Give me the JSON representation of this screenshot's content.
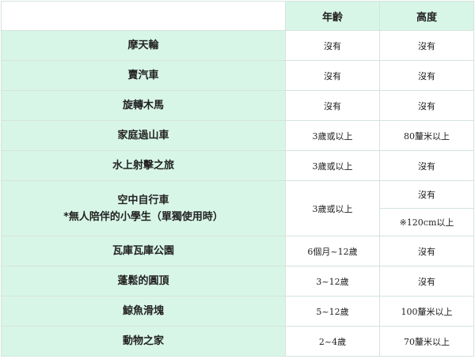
{
  "headers": {
    "age": "年齡",
    "height": "高度"
  },
  "rows": [
    {
      "name": "摩天輪",
      "age": "沒有",
      "height": "沒有"
    },
    {
      "name": "賣汽車",
      "age": "沒有",
      "height": "沒有"
    },
    {
      "name": "旋轉木馬",
      "age": "沒有",
      "height": "沒有"
    },
    {
      "name": "家庭過山車",
      "age": "3歲或以上",
      "height": "80釐米以上"
    },
    {
      "name": "水上射擊之旅",
      "age": "3歲或以上",
      "height": "沒有"
    },
    {
      "name": "空中自行車",
      "note": "*無人陪伴的小學生（單獨使用時）",
      "age": "3歲或以上",
      "height": "沒有",
      "height_note": "※120cm以上"
    },
    {
      "name": "瓦庫瓦庫公園",
      "age": "6個月~12歲",
      "height": "沒有"
    },
    {
      "name": "蓬鬆的圓頂",
      "age": "3~12歲",
      "height": "沒有"
    },
    {
      "name": "鯨魚滑塊",
      "age": "5~12歲",
      "height": "100釐米以上"
    },
    {
      "name": "動物之家",
      "age": "2~4歲",
      "height": "70釐米以上"
    }
  ]
}
